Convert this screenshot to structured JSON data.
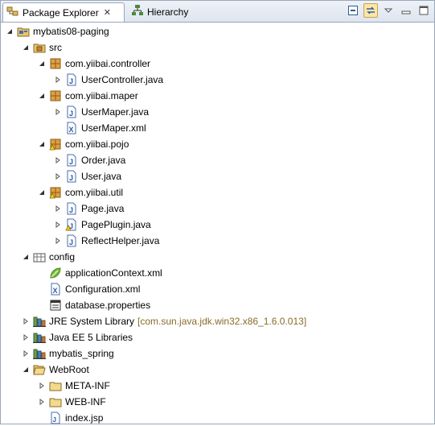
{
  "tabs": {
    "package_explorer": "Package Explorer",
    "hierarchy": "Hierarchy"
  },
  "tree": [
    {
      "label": "mybatis08-paging",
      "icon": "project-icon",
      "twisty": "expanded",
      "depth": 0
    },
    {
      "label": "src",
      "icon": "source-folder-icon",
      "twisty": "expanded",
      "depth": 1
    },
    {
      "label": "com.yiibai.controller",
      "icon": "package-icon",
      "twisty": "expanded",
      "depth": 2
    },
    {
      "label": "UserController.java",
      "icon": "java-file-icon",
      "twisty": "collapsed",
      "depth": 3
    },
    {
      "label": "com.yiibai.maper",
      "icon": "package-icon",
      "twisty": "expanded",
      "depth": 2
    },
    {
      "label": "UserMaper.java",
      "icon": "java-file-icon",
      "twisty": "collapsed",
      "depth": 3
    },
    {
      "label": "UserMaper.xml",
      "icon": "xml-file-icon",
      "twisty": "none",
      "depth": 3
    },
    {
      "label": "com.yiibai.pojo",
      "icon": "package-warning-icon",
      "twisty": "expanded",
      "depth": 2
    },
    {
      "label": "Order.java",
      "icon": "java-file-icon",
      "twisty": "collapsed",
      "depth": 3
    },
    {
      "label": "User.java",
      "icon": "java-file-icon",
      "twisty": "collapsed",
      "depth": 3
    },
    {
      "label": "com.yiibai.util",
      "icon": "package-warning-icon",
      "twisty": "expanded",
      "depth": 2
    },
    {
      "label": "Page.java",
      "icon": "java-file-icon",
      "twisty": "collapsed",
      "depth": 3
    },
    {
      "label": "PagePlugin.java",
      "icon": "java-file-warning-icon",
      "twisty": "collapsed",
      "depth": 3
    },
    {
      "label": "ReflectHelper.java",
      "icon": "java-file-icon",
      "twisty": "collapsed",
      "depth": 3
    },
    {
      "label": "config",
      "icon": "config-folder-icon",
      "twisty": "expanded",
      "depth": 1
    },
    {
      "label": "applicationContext.xml",
      "icon": "spring-leaf-icon",
      "twisty": "none",
      "depth": 2
    },
    {
      "label": "Configuration.xml",
      "icon": "xml-file-icon",
      "twisty": "none",
      "depth": 2
    },
    {
      "label": "database.properties",
      "icon": "properties-file-icon",
      "twisty": "none",
      "depth": 2
    },
    {
      "label": "JRE System Library",
      "decoration": "[com.sun.java.jdk.win32.x86_1.6.0.013]",
      "icon": "library-icon",
      "twisty": "collapsed",
      "depth": 1
    },
    {
      "label": "Java EE 5 Libraries",
      "icon": "library-icon",
      "twisty": "collapsed",
      "depth": 1
    },
    {
      "label": "mybatis_spring",
      "icon": "library-icon",
      "twisty": "collapsed",
      "depth": 1
    },
    {
      "label": "WebRoot",
      "icon": "folder-open-icon",
      "twisty": "expanded",
      "depth": 1
    },
    {
      "label": "META-INF",
      "icon": "folder-icon",
      "twisty": "collapsed",
      "depth": 2
    },
    {
      "label": "WEB-INF",
      "icon": "folder-icon",
      "twisty": "collapsed",
      "depth": 2
    },
    {
      "label": "index.jsp",
      "icon": "jsp-file-icon",
      "twisty": "none",
      "depth": 2
    }
  ]
}
